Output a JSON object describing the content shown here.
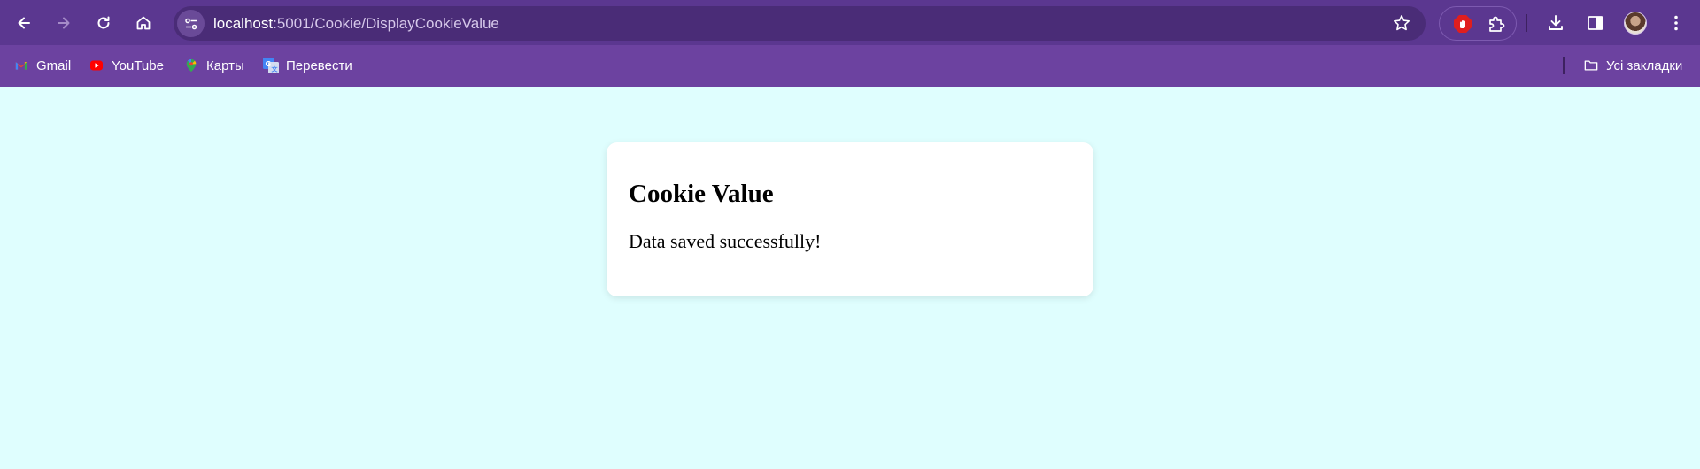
{
  "browser": {
    "url_host": "localhost",
    "url_path": ":5001/Cookie/DisplayCookieValue",
    "bookmarks": [
      {
        "label": "Gmail",
        "icon": "gmail-icon"
      },
      {
        "label": "YouTube",
        "icon": "youtube-icon"
      },
      {
        "label": "Карты",
        "icon": "maps-icon"
      },
      {
        "label": "Перевести",
        "icon": "translate-icon"
      }
    ],
    "all_bookmarks_label": "Усі закладки",
    "colors": {
      "toolbar": "#5b3790",
      "bookmarks_bar": "#6c42a0",
      "omnibox": "#4a2c77"
    }
  },
  "page": {
    "background": "#dffefe",
    "card": {
      "title": "Cookie Value",
      "message": "Data saved successfully!"
    }
  }
}
